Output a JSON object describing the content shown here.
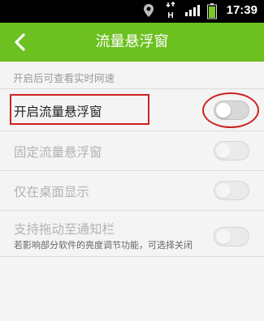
{
  "status_bar": {
    "time": "17:39",
    "icons": [
      "location-icon",
      "network-h-icon",
      "signal-bars-icon",
      "battery-icon"
    ],
    "network_type": "H"
  },
  "app_bar": {
    "title": "流量悬浮窗",
    "back_icon": "chevron-left-icon",
    "color": "#6cc020"
  },
  "section": {
    "header": "开启后可查看实时网速"
  },
  "settings": [
    {
      "label": "开启流量悬浮窗",
      "enabled": true,
      "checked": false
    },
    {
      "label": "固定流量悬浮窗",
      "enabled": false,
      "checked": false
    },
    {
      "label": "仅在桌面显示",
      "enabled": false,
      "checked": false
    },
    {
      "label": "支持拖动至通知栏",
      "sublabel": "若影响部分软件的亮度调节功能，可选择关闭",
      "enabled": false,
      "checked": false
    }
  ],
  "annotation_color": "#cc2222"
}
